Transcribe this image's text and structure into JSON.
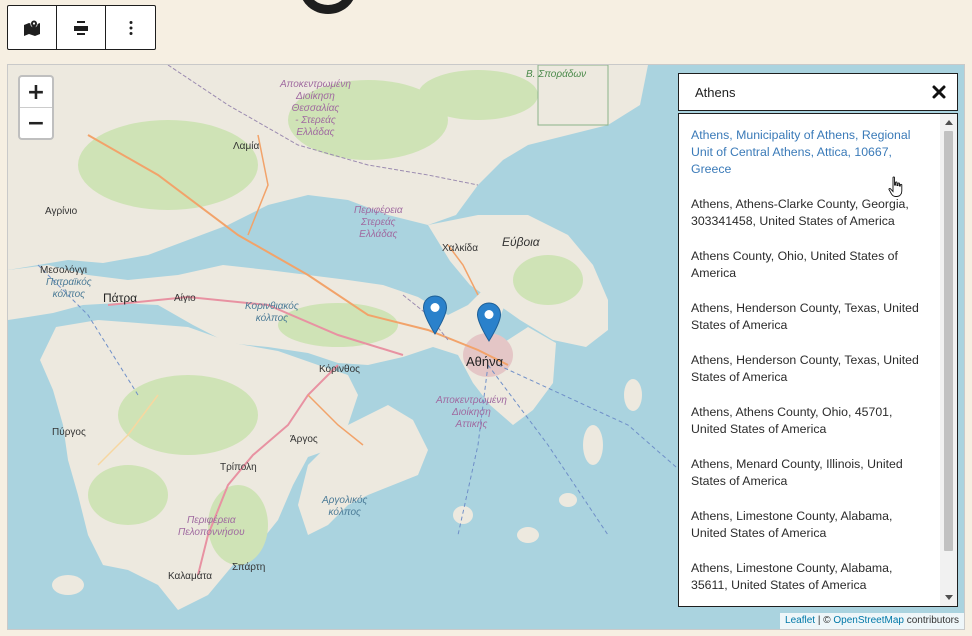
{
  "toolbar": {
    "buttons": [
      {
        "name": "map-marker-icon"
      },
      {
        "name": "align-center-icon"
      },
      {
        "name": "more-options-icon"
      }
    ]
  },
  "map": {
    "zoom_in_label": "+",
    "zoom_out_label": "−",
    "labels": {
      "lamia": "Λαμία",
      "agrinio": "Αγρίνιο",
      "mesolongi": "Μεσολόγγι",
      "patraikos": "Πατραϊκός\nκόλπος",
      "patra": "Πάτρα",
      "aigio": "Αίγιο",
      "korinthiakos": "Κορινθιακός\nκόλπος",
      "korinthos": "Κόρινθος",
      "chalkida": "Χαλκίδα",
      "evia": "Εύβοια",
      "athina": "Αθήνα",
      "thessaly_region": "Αποκεντρωμένη\nΔιοίκηση\nΘεσσαλίας\n- Στερεάς\nΕλλάδας",
      "sterea_region": "Περιφέρεια\nΣτερεάς\nΕλλάδας",
      "attiki_region": "Αποκεντρωμένη\nΔιοίκηση\nΑττικής",
      "pyrgos": "Πύργος",
      "argos": "Άργος",
      "tripoli": "Τρίπολη",
      "argolikos": "Αργολικός\nκόλπος",
      "peloponnisos_region": "Περιφέρεια\nΠελοποννήσου",
      "kalamata": "Καλαμάτα",
      "sparti": "Σπάρτη",
      "sporades": "Β. Σποράδων"
    },
    "marker_color": "#2a81cb",
    "attribution": {
      "leaflet": "Leaflet",
      "separator": " | © ",
      "osm": "OpenStreetMap",
      "suffix": " contributors"
    }
  },
  "search": {
    "value": "Athens",
    "results": [
      "Athens, Municipality of Athens, Regional Unit of Central Athens, Attica, 10667, Greece",
      "Athens, Athens-Clarke County, Georgia, 303341458, United States of America",
      "Athens County, Ohio, United States of America",
      "Athens, Henderson County, Texas, United States of America",
      "Athens, Henderson County, Texas, United States of America",
      "Athens, Athens County, Ohio, 45701, United States of America",
      "Athens, Menard County, Illinois, United States of America",
      "Athens, Limestone County, Alabama, United States of America",
      "Athens, Limestone County, Alabama, 35611, United States of America"
    ],
    "active_index": 0
  },
  "colors": {
    "sea": "#aad3df",
    "land": "#ede9df",
    "forest": "#cfe3b6",
    "link": "#3a7ab8"
  }
}
